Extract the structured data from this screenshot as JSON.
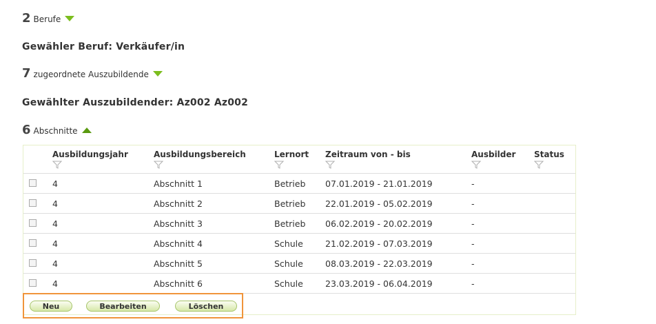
{
  "sections": {
    "berufe": {
      "count": "2",
      "label": "Berufe"
    },
    "selected_beruf": "Gewähler Beruf: Verkäufer/in",
    "auszubildende": {
      "count": "7",
      "label": "zugeordnete Auszubildende"
    },
    "selected_azubi": "Gewählter Auszubildender: Az002 Az002",
    "abschnitte": {
      "count": "6",
      "label": "Abschnitte"
    }
  },
  "table": {
    "columns": [
      "Ausbildungsjahr",
      "Ausbildungsbereich",
      "Lernort",
      "Zeitraum von - bis",
      "Ausbilder",
      "Status"
    ],
    "rows": [
      {
        "jahr": "4",
        "bereich": "Abschnitt 1",
        "lernort": "Betrieb",
        "zeitraum": "07.01.2019 - 21.01.2019",
        "ausbilder": "-",
        "status": ""
      },
      {
        "jahr": "4",
        "bereich": "Abschnitt 2",
        "lernort": "Betrieb",
        "zeitraum": "22.01.2019 - 05.02.2019",
        "ausbilder": "-",
        "status": ""
      },
      {
        "jahr": "4",
        "bereich": "Abschnitt 3",
        "lernort": "Betrieb",
        "zeitraum": "06.02.2019 - 20.02.2019",
        "ausbilder": "-",
        "status": ""
      },
      {
        "jahr": "4",
        "bereich": "Abschnitt 4",
        "lernort": "Schule",
        "zeitraum": "21.02.2019 - 07.03.2019",
        "ausbilder": "-",
        "status": ""
      },
      {
        "jahr": "4",
        "bereich": "Abschnitt 5",
        "lernort": "Schule",
        "zeitraum": "08.03.2019 - 22.03.2019",
        "ausbilder": "-",
        "status": ""
      },
      {
        "jahr": "4",
        "bereich": "Abschnitt 6",
        "lernort": "Schule",
        "zeitraum": "23.03.2019 - 06.04.2019",
        "ausbilder": "-",
        "status": ""
      }
    ]
  },
  "buttons": {
    "neu": "Neu",
    "bearbeiten": "Bearbeiten",
    "loeschen": "Löschen"
  },
  "colors": {
    "accent_green": "#7cbd1e",
    "highlight_orange": "#f0943a",
    "table_border": "#e6efc9"
  },
  "icons": {
    "expand": "triangle-down-icon",
    "collapse": "triangle-up-icon",
    "filter": "filter-funnel-icon",
    "checkbox": "checkbox-icon"
  }
}
